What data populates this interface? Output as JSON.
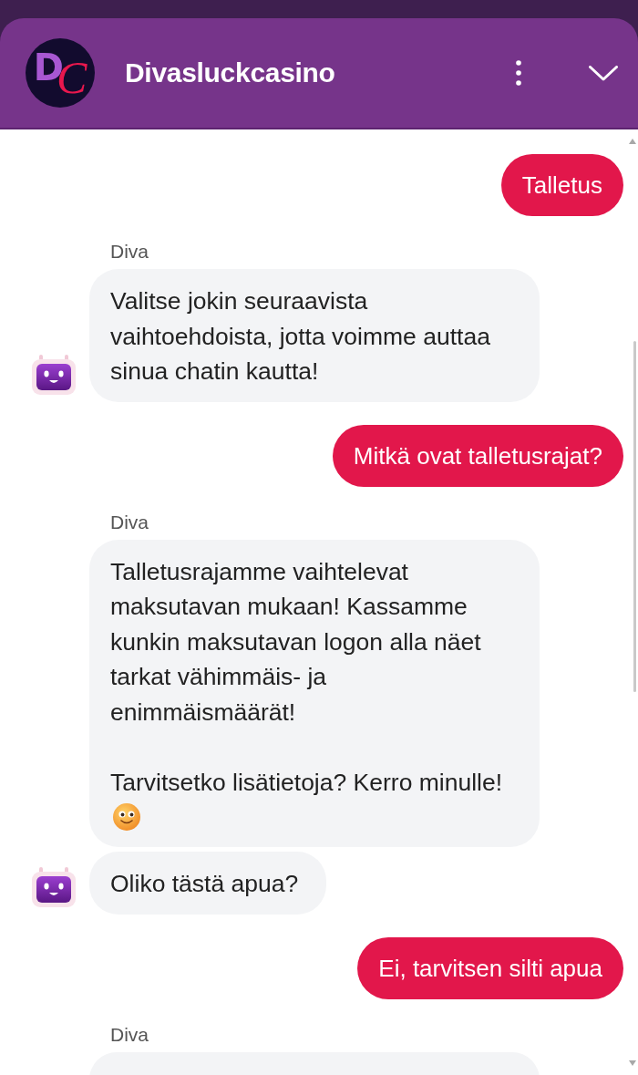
{
  "header": {
    "logo_letters": [
      "D",
      "C"
    ],
    "title": "Divasluckcasino"
  },
  "messages": [
    {
      "kind": "user",
      "text": "Talletus"
    },
    {
      "kind": "sender",
      "text": "Diva"
    },
    {
      "kind": "bot",
      "avatar": true,
      "emoji": false,
      "paragraphs": [
        "Valitse jokin seuraavista vaihtoehdoista, jotta voimme auttaa sinua chatin kautta!"
      ]
    },
    {
      "kind": "user",
      "text": "Mitkä ovat talletusrajat?"
    },
    {
      "kind": "sender",
      "text": "Diva"
    },
    {
      "kind": "bot",
      "avatar": false,
      "emoji": true,
      "paragraphs": [
        "Talletusrajamme vaihtelevat maksutavan mukaan! Kassamme kunkin maksutavan logon alla näet tarkat vähimmäis- ja enimmäismäärät!",
        "Tarvitsetko lisätietoja? Kerro minulle!"
      ]
    },
    {
      "kind": "bot",
      "avatar": true,
      "emoji": false,
      "paragraphs": [
        "Oliko tästä apua?"
      ]
    },
    {
      "kind": "user",
      "text": "Ei, tarvitsen silti apua"
    },
    {
      "kind": "sender",
      "text": "Diva"
    },
    {
      "kind": "bot_partial"
    }
  ]
}
